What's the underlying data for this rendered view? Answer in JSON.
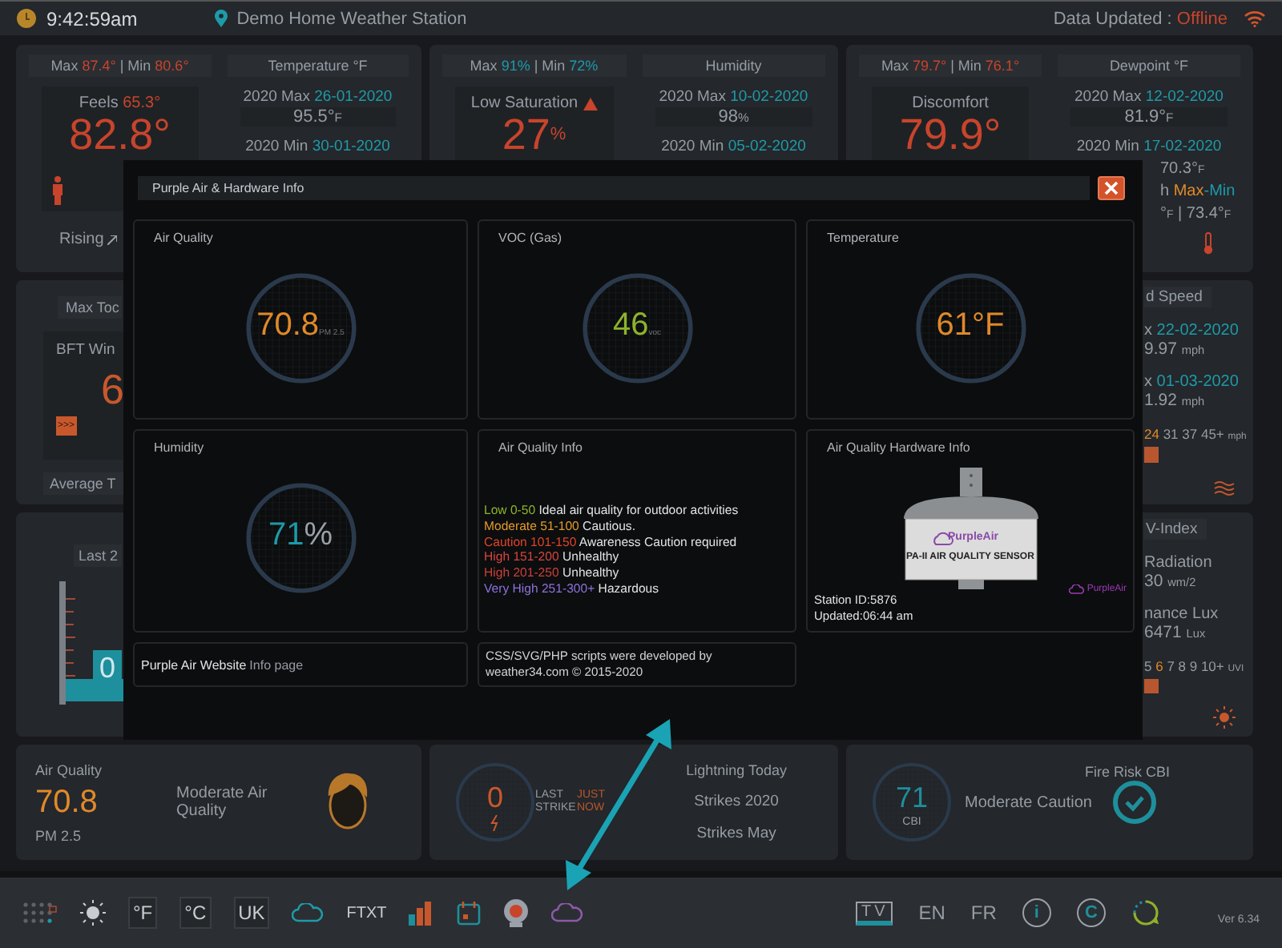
{
  "top_bar": {
    "time": "9:42:59am",
    "station": "Demo Home Weather Station",
    "status": [
      {
        "text": "Data Updated : ",
        "kind": "plain"
      },
      {
        "text": "Offline",
        "kind": "red"
      }
    ]
  },
  "overview": [
    {
      "maxmin": [
        {
          "text": "Max ",
          "kind": "plain"
        },
        {
          "text": "87.4°",
          "kind": "red"
        },
        {
          "text": " | Min ",
          "kind": "plain"
        },
        {
          "text": "80.6°",
          "kind": "red"
        }
      ],
      "box_title": [
        {
          "text": "Feels ",
          "kind": "plain"
        },
        {
          "text": "65.3°",
          "kind": "red"
        }
      ],
      "alert": false,
      "big": "82.8°",
      "trend": "Rising",
      "header": "Temperature °F",
      "records": [
        {
          "label": [
            {
              "text": "2020 Max ",
              "kind": "plain"
            },
            {
              "text": "26-01-2020",
              "kind": "teal"
            }
          ],
          "value": [
            {
              "text": "95.5°",
              "kind": "plain"
            },
            {
              "text": "F",
              "kind": "unit"
            }
          ]
        },
        {
          "label": [
            {
              "text": "2020 Min ",
              "kind": "plain"
            },
            {
              "text": "30-01-2020",
              "kind": "teal"
            }
          ]
        }
      ]
    },
    {
      "maxmin": [
        {
          "text": "Max ",
          "kind": "plain"
        },
        {
          "text": "91%",
          "kind": "teal"
        },
        {
          "text": " | Min ",
          "kind": "plain"
        },
        {
          "text": "72%",
          "kind": "teal"
        }
      ],
      "box_title": [
        {
          "text": "Low Saturation ",
          "kind": "plain"
        }
      ],
      "alert": true,
      "big": "27",
      "big_unit": "%",
      "header": "Humidity",
      "records": [
        {
          "label": [
            {
              "text": "2020 Max ",
              "kind": "plain"
            },
            {
              "text": "10-02-2020",
              "kind": "teal"
            }
          ],
          "value": [
            {
              "text": "98",
              "kind": "plain"
            },
            {
              "text": "%",
              "kind": "unit"
            }
          ]
        },
        {
          "label": [
            {
              "text": "2020 Min ",
              "kind": "plain"
            },
            {
              "text": "05-02-2020",
              "kind": "teal"
            }
          ]
        }
      ]
    },
    {
      "maxmin": [
        {
          "text": "Max ",
          "kind": "plain"
        },
        {
          "text": "79.7°",
          "kind": "red"
        },
        {
          "text": " | Min ",
          "kind": "plain"
        },
        {
          "text": "76.1°",
          "kind": "red"
        }
      ],
      "box_title": [
        {
          "text": "Discomfort",
          "kind": "plain"
        }
      ],
      "alert": false,
      "big": "79.9°",
      "header": "Dewpoint °F",
      "records": [
        {
          "label": [
            {
              "text": "2020 Max ",
              "kind": "plain"
            },
            {
              "text": "12-02-2020",
              "kind": "teal"
            }
          ],
          "value": [
            {
              "text": "81.9°",
              "kind": "plain"
            },
            {
              "text": "F",
              "kind": "unit"
            }
          ]
        },
        {
          "label": [
            {
              "text": "2020 Min ",
              "kind": "plain"
            },
            {
              "text": "17-02-2020",
              "kind": "teal"
            }
          ],
          "value": [
            {
              "text": "70.3°",
              "kind": "plain"
            },
            {
              "text": "F",
              "kind": "unit"
            }
          ]
        }
      ],
      "extra": [
        [
          {
            "text": "h ",
            "kind": "plain"
          },
          {
            "text": "Max",
            "kind": "orange"
          },
          {
            "text": "-Min",
            "kind": "teal"
          }
        ],
        [
          {
            "text": "°",
            "kind": "plain"
          },
          {
            "text": "F",
            "kind": "unit"
          },
          {
            "text": " | 73.4°",
            "kind": "plain"
          },
          {
            "text": "F",
            "kind": "unit"
          }
        ]
      ]
    }
  ],
  "wind_strip": {
    "title": "Max Toc",
    "box_title": "BFT Win",
    "big": "6",
    "badge": ">>>",
    "footer": "Average T"
  },
  "rain_strip": {
    "title": "Last 2",
    "reading": "0"
  },
  "wind_speed_strip": {
    "title": "d Speed",
    "records": [
      {
        "label": [
          {
            "text": "x ",
            "kind": "plain"
          },
          {
            "text": "22-02-2020",
            "kind": "teal"
          }
        ],
        "value": [
          {
            "text": "9.97 ",
            "kind": "plain"
          },
          {
            "text": "mph",
            "kind": "unit"
          }
        ]
      },
      {
        "label": [
          {
            "text": "x ",
            "kind": "plain"
          },
          {
            "text": "01-03-2020",
            "kind": "teal"
          }
        ],
        "value": [
          {
            "text": "1.92 ",
            "kind": "plain"
          },
          {
            "text": "mph",
            "kind": "unit"
          }
        ]
      }
    ],
    "scale": [
      {
        "text": "24",
        "kind": "orange"
      },
      {
        "text": " 31 37 45+ ",
        "kind": "plain"
      },
      {
        "text": "mph",
        "kind": "unit"
      }
    ]
  },
  "uv_strip": {
    "title": "V-Index",
    "records": [
      {
        "label": "Radiation",
        "value": [
          {
            "text": "30 ",
            "kind": "plain"
          },
          {
            "text": "wm/2",
            "kind": "unit"
          }
        ]
      },
      {
        "label": "nance Lux",
        "value": [
          {
            "text": "6471 ",
            "kind": "plain"
          },
          {
            "text": "Lux",
            "kind": "unit"
          }
        ]
      }
    ],
    "scale": [
      {
        "text": "5 ",
        "kind": "plain"
      },
      {
        "text": "6",
        "kind": "orange"
      },
      {
        "text": " 7 8 9 10+ ",
        "kind": "plain"
      },
      {
        "text": "UVI",
        "kind": "unit"
      }
    ]
  },
  "air_quality": {
    "title": "Air Quality",
    "value": "70.8",
    "unit": "PM 2.5",
    "status": "Moderate Air Quality"
  },
  "lightning": {
    "title": "Lightning Today",
    "value": "0",
    "last_label": "LAST STRIKE",
    "last_value": "JUST NOW",
    "lines": [
      "Strikes 2020",
      "Strikes May"
    ]
  },
  "fire_risk": {
    "title": "Fire Risk CBI",
    "value": "71",
    "unit": "CBI",
    "status": "Moderate Caution"
  },
  "modal": {
    "title": "Purple Air & Hardware Info",
    "gauges": [
      {
        "title": "Air Quality",
        "value": "70.8",
        "unit": "PM 2.5",
        "kind": "subscript",
        "color": "#e0892a"
      },
      {
        "title": "VOC (Gas)",
        "value": "46",
        "unit": "voc",
        "kind": "subscript",
        "color": "#8db32b"
      },
      {
        "title": "Temperature",
        "value": "61°F",
        "kind": "plain",
        "color": "#e0892a"
      },
      {
        "title": "Humidity",
        "value": "71",
        "unit": "%",
        "kind": "suffix",
        "color": "#1e9aa8"
      }
    ],
    "info": {
      "title": "Air Quality Info",
      "levels": [
        {
          "range": "Low 0-50",
          "text": "Ideal air quality for outdoor activities",
          "color": "#8db32b"
        },
        {
          "range": "Moderate 51-100",
          "text": "Cautious.",
          "color": "#e39a2b"
        },
        {
          "range": "Caution 101-150",
          "text": "Awareness Caution required",
          "color": "#e0442a"
        },
        {
          "range": "High 151-200",
          "text": "Unhealthy",
          "color": "#d8453f"
        },
        {
          "range": "High 201-250",
          "text": "Unhealthy",
          "color": "#c9403a"
        },
        {
          "range": "Very High 251-300+",
          "text": "Hazardous",
          "color": "#8c72dc"
        }
      ]
    },
    "hardware": {
      "title": "Air Quality Hardware Info",
      "brand": "PurpleAir",
      "model": "PA-II AIR QUALITY SENSOR",
      "logo": "PurpleAir",
      "station": "Station ID:5876",
      "updated": "Updated:06:44 am"
    },
    "website": {
      "link": "Purple Air Website",
      "suffix": "Info page"
    },
    "credit": "CSS/SVG/PHP scripts were developed by weather34.com © 2015-2020"
  },
  "toolbar_left": [
    {
      "kind": "grid"
    },
    {
      "kind": "sun"
    },
    {
      "kind": "boxed",
      "label": "°F"
    },
    {
      "kind": "boxed",
      "label": "°C"
    },
    {
      "kind": "boxed",
      "label": "UK"
    },
    {
      "kind": "cloud",
      "color": "#1e9aa8"
    },
    {
      "kind": "text",
      "label": "FTXT"
    },
    {
      "kind": "chart"
    },
    {
      "kind": "calendar"
    },
    {
      "kind": "webcam"
    },
    {
      "kind": "cloud",
      "color": "#8a5aa8"
    }
  ],
  "toolbar_right": [
    {
      "kind": "tv",
      "label": "TV"
    },
    {
      "kind": "text",
      "label": "EN"
    },
    {
      "kind": "text",
      "label": "FR"
    },
    {
      "kind": "circled",
      "label": "i"
    },
    {
      "kind": "circled",
      "label": "C"
    },
    {
      "kind": "refresh"
    }
  ],
  "version": "Ver 6.34"
}
